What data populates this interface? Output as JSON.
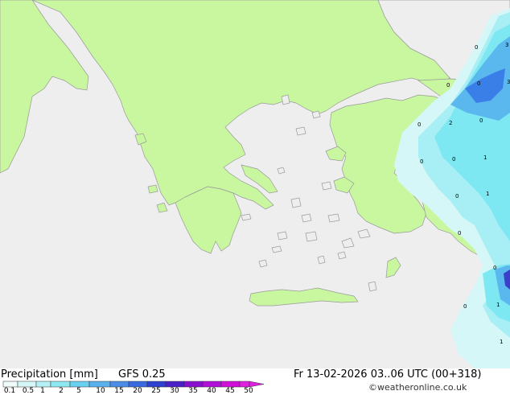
{
  "map": {
    "colors": {
      "sea": "#eeeeee",
      "land": "#c8f7a0",
      "coast": "#999999",
      "precip_light": "#d6f7f7",
      "precip_mid": "#a8eef5",
      "precip_cyan": "#7ee8f2",
      "precip_blue": "#5ab8ee",
      "precip_deep": "#3a7fe8",
      "precip_purple": "#3a40c8"
    },
    "value_labels": [
      "0",
      "0",
      "0",
      "2",
      "0",
      "0",
      "0",
      "1",
      "0",
      "0",
      "1",
      "0",
      "0",
      "1",
      "1",
      "3",
      "3"
    ]
  },
  "footer": {
    "title": "Precipitation [mm]",
    "model": "GFS 0.25",
    "datetime": "Fr 13-02-2026 03..06 UTC (00+318)",
    "watermark": "©weatheronline.co.uk",
    "legend_ticks": [
      "0.1",
      "0.5",
      "1",
      "2",
      "5",
      "10",
      "15",
      "20",
      "25",
      "30",
      "35",
      "40",
      "45",
      "50"
    ],
    "legend_colors": [
      "#f0fcfc",
      "#d6f7f7",
      "#b4f0f5",
      "#8ee8f2",
      "#6ad0f0",
      "#5ab0ec",
      "#4a8ce6",
      "#3a6ae0",
      "#2e40d0",
      "#4a20c8",
      "#8a10d0",
      "#b010d8",
      "#d010d8",
      "#e020e0"
    ]
  }
}
